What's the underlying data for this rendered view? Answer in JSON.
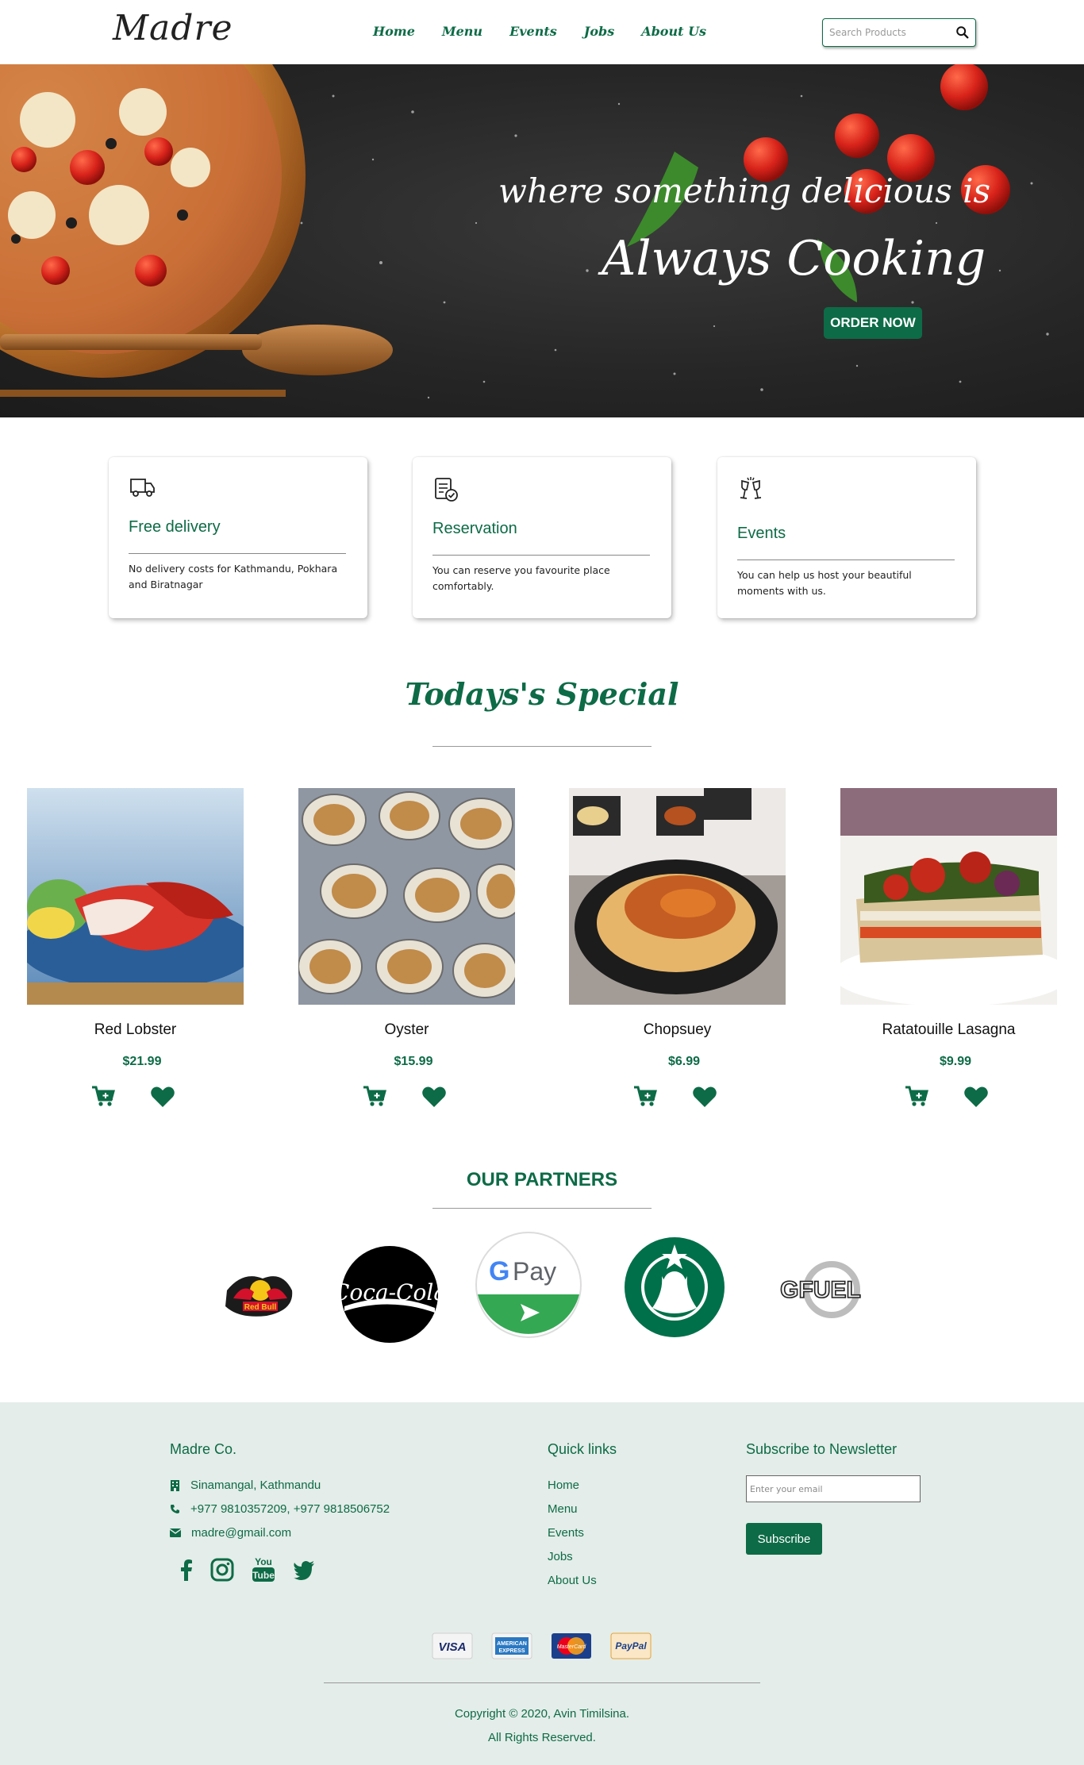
{
  "brand": {
    "logo": "Madre",
    "accent_color": "#0d6b47"
  },
  "nav": {
    "items": [
      "Home",
      "Menu",
      "Events",
      "Jobs",
      "About Us"
    ],
    "search_placeholder": "Search Products",
    "search_icon": "search-icon"
  },
  "hero": {
    "tagline": "where something delicious is",
    "headline": "Always Cooking",
    "cta": "ORDER NOW"
  },
  "features": [
    {
      "icon": "truck-icon",
      "title": "Free delivery",
      "description": "No delivery costs for Kathmandu, Pokhara and Biratnagar"
    },
    {
      "icon": "reservation-icon",
      "title": "Reservation",
      "description": "You can reserve you favourite place comfortably."
    },
    {
      "icon": "champagne-glasses-icon",
      "title": "Events",
      "description": "You can help us host your beautiful moments with us."
    }
  ],
  "specials": {
    "title": "Todays's Special",
    "products": [
      {
        "name": "Red Lobster",
        "price": "$21.99"
      },
      {
        "name": "Oyster",
        "price": "$15.99"
      },
      {
        "name": "Chopsuey",
        "price": "$6.99"
      },
      {
        "name": "Ratatouille Lasagna",
        "price": "$9.99"
      }
    ]
  },
  "partners": {
    "title": "OUR PARTNERS",
    "logos": [
      "Red Bull",
      "Coca-Cola",
      "G Pay",
      "Starbucks",
      "G FUEL"
    ]
  },
  "footer": {
    "company": {
      "title": "Madre Co.",
      "address": "Sinamangal, Kathmandu",
      "phone": "+977 9810357209, +977 9818506752",
      "email": "madre@gmail.com"
    },
    "quick_links": {
      "title": "Quick links",
      "items": [
        "Home",
        "Menu",
        "Events",
        "Jobs",
        "About Us"
      ]
    },
    "newsletter": {
      "title": "Subscribe to Newsletter",
      "placeholder": "Enter your email",
      "button": "Subscribe"
    },
    "payments": [
      "VISA",
      "AMERICAN EXPRESS",
      "MasterCard",
      "PayPal"
    ],
    "copyright_line1": "Copyright © 2020, Avin Timilsina.",
    "copyright_line2": "All Rights Reserved."
  }
}
